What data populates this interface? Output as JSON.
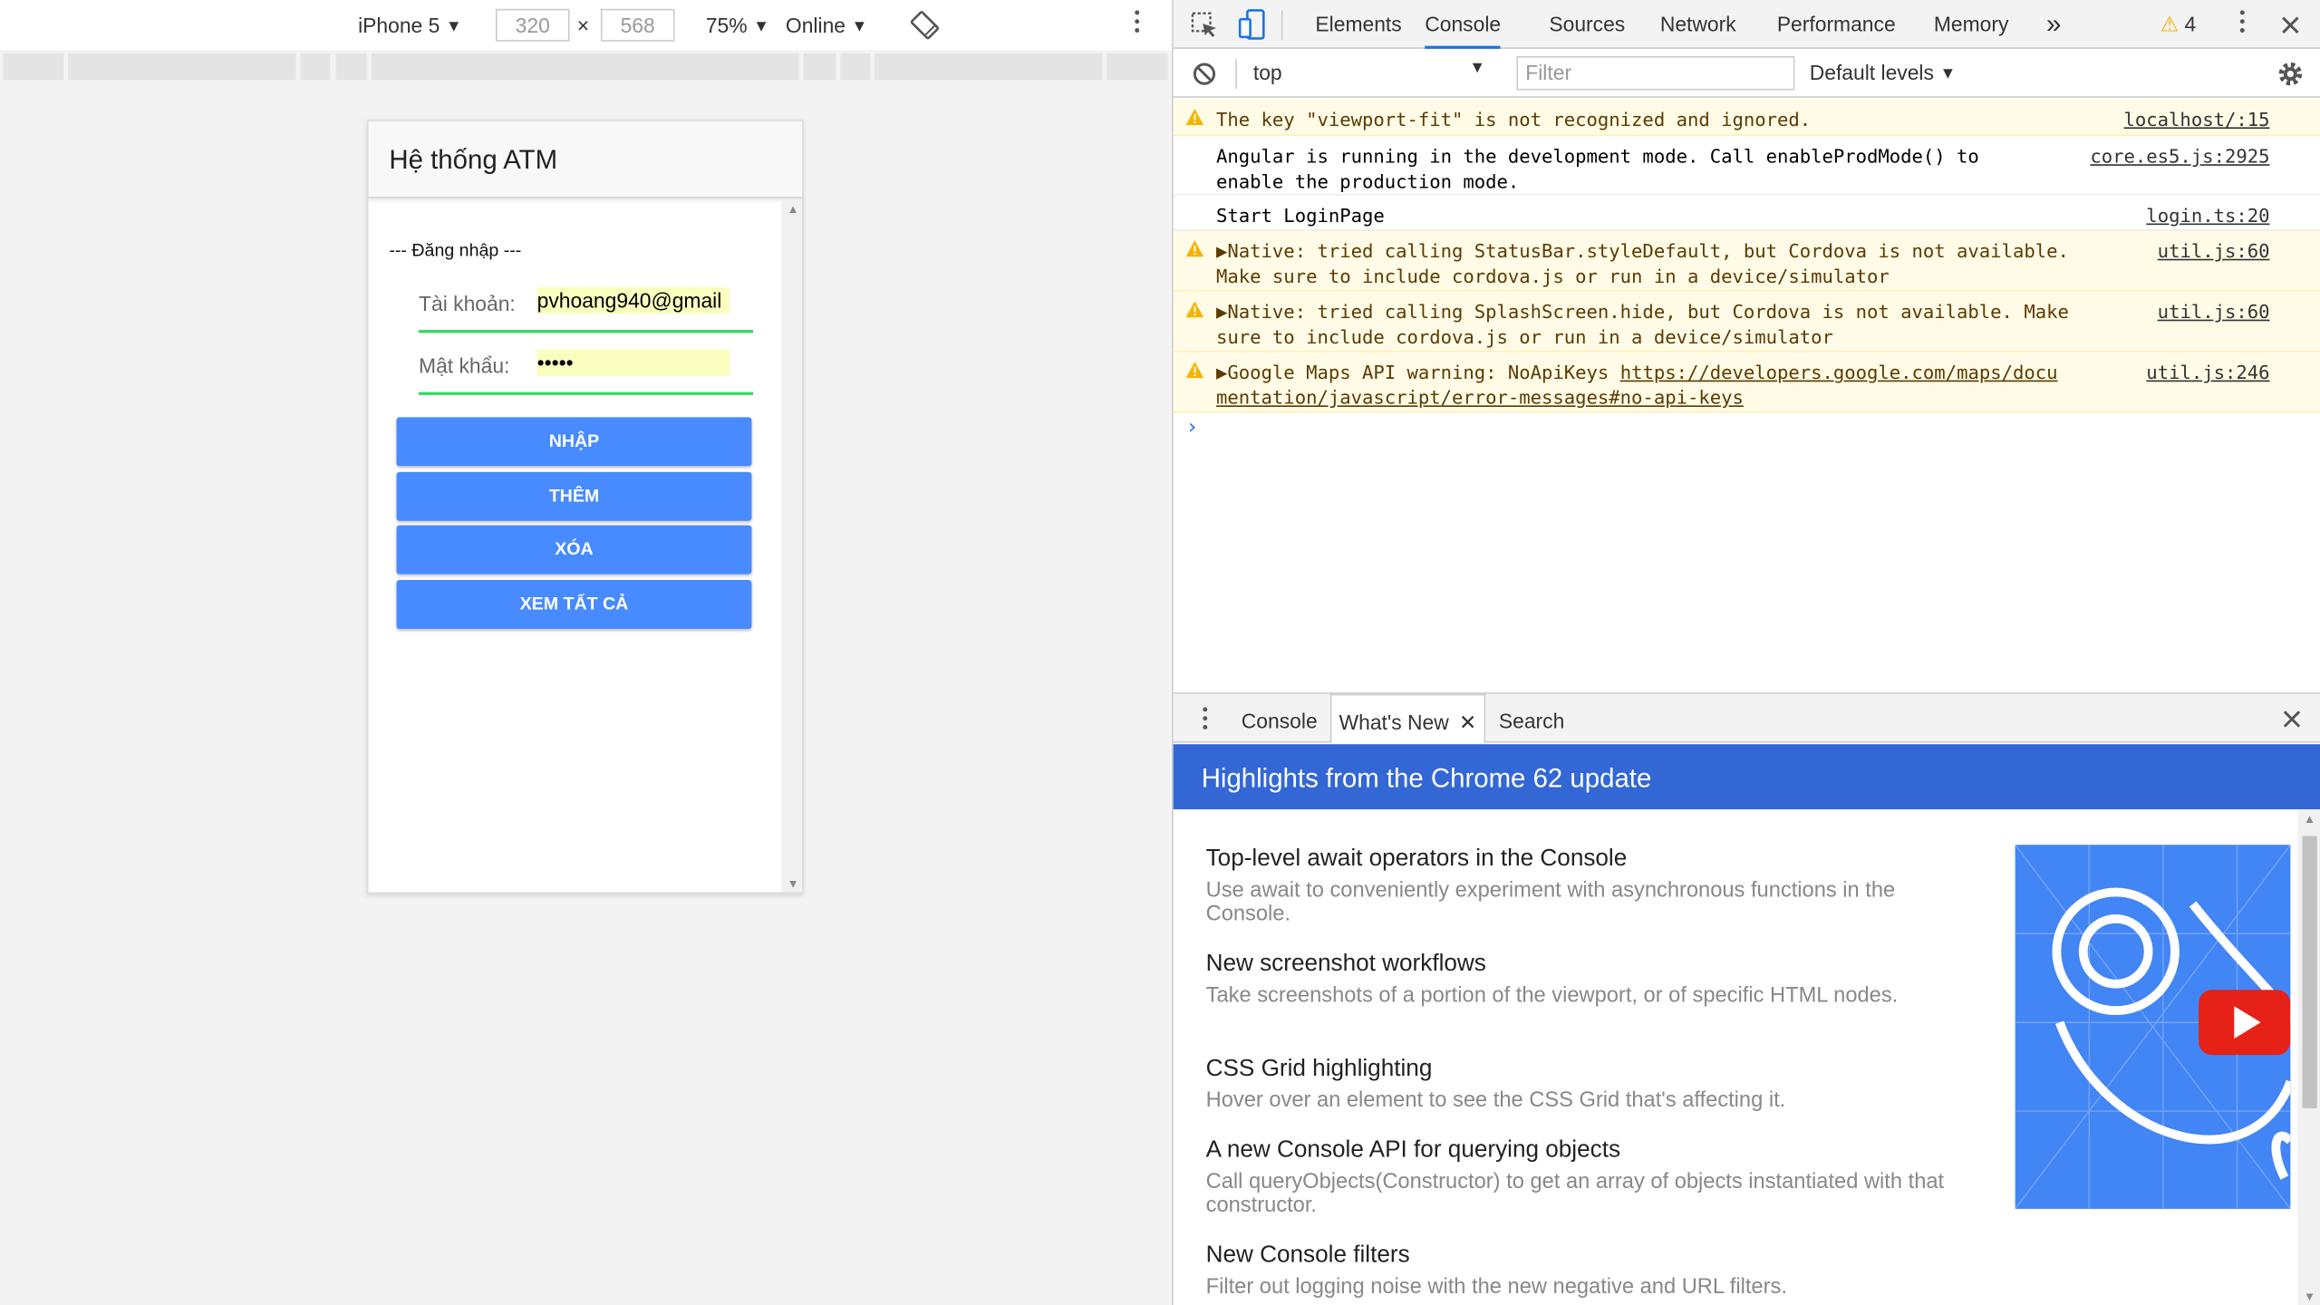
{
  "device_toolbar": {
    "device": "iPhone 5",
    "width": "320",
    "times": "×",
    "height": "568",
    "zoom": "75%",
    "network": "Online"
  },
  "app": {
    "title": "Hệ thống ATM",
    "section": "--- Đăng nhập ---",
    "username_label": "Tài khoản:",
    "username_value": "pvhoang940@gmail",
    "password_label": "Mật khẩu:",
    "password_value": "•••••",
    "buttons": [
      "NHẬP",
      "THÊM",
      "XÓA",
      "XEM TẤT CẢ"
    ]
  },
  "devtools": {
    "tabs": [
      "Elements",
      "Console",
      "Sources",
      "Network",
      "Performance",
      "Memory"
    ],
    "active_tab": "Console",
    "more": "»",
    "warning_count": "4",
    "context": "top",
    "filter_placeholder": "Filter",
    "levels": "Default levels",
    "messages": [
      {
        "type": "warn",
        "text": "The key \"viewport-fit\" is not recognized and ignored.",
        "source": "localhost/:15"
      },
      {
        "type": "log",
        "text": "Angular is running in the development mode. Call enableProdMode() to\nenable the production mode.",
        "source": "core.es5.js:2925"
      },
      {
        "type": "log",
        "text": "Start LoginPage",
        "source": "login.ts:20"
      },
      {
        "type": "warn",
        "text": "▶Native: tried calling StatusBar.styleDefault, but Cordova is not available.\nMake sure to include cordova.js or run in a device/simulator",
        "source": "util.js:60"
      },
      {
        "type": "warn",
        "text": "▶Native: tried calling SplashScreen.hide, but Cordova is not available. Make\nsure to include cordova.js or run in a device/simulator",
        "source": "util.js:60"
      },
      {
        "type": "warn",
        "text_prefix": "▶Google Maps API warning: NoApiKeys ",
        "link": "https://developers.google.com/maps/docu\nmentation/javascript/error-messages#no-api-keys",
        "source": "util.js:246"
      }
    ],
    "prompt": "›"
  },
  "drawer": {
    "tabs": [
      "Console",
      "What's New",
      "Search"
    ],
    "active_tab": "What's New",
    "banner": "Highlights from the Chrome 62 update",
    "features": [
      {
        "title": "Top-level await operators in the Console",
        "desc": "Use await to conveniently experiment with asynchronous functions in the Console."
      },
      {
        "title": "New screenshot workflows",
        "desc": "Take screenshots of a portion of the viewport, or of specific HTML nodes."
      },
      {
        "title": "CSS Grid highlighting",
        "desc": "Hover over an element to see the CSS Grid that's affecting it."
      },
      {
        "title": "A new Console API for querying objects",
        "desc": "Call queryObjects(Constructor) to get an array of objects instantiated with that constructor."
      },
      {
        "title": "New Console filters",
        "desc": "Filter out logging noise with the new negative and URL filters."
      }
    ]
  },
  "colors": {
    "ionic_primary": "#488aff",
    "ionic_secondary": "#32db64",
    "autofill": "#faffbd",
    "devtools_banner": "#3367d6",
    "warning_bg": "#fffbe6"
  },
  "icons": [
    "rotate-icon",
    "inspect-icon",
    "device-toggle-icon",
    "warning-icon",
    "kebab-icon",
    "close-icon",
    "clear-console-icon",
    "gear-icon",
    "play-icon"
  ]
}
